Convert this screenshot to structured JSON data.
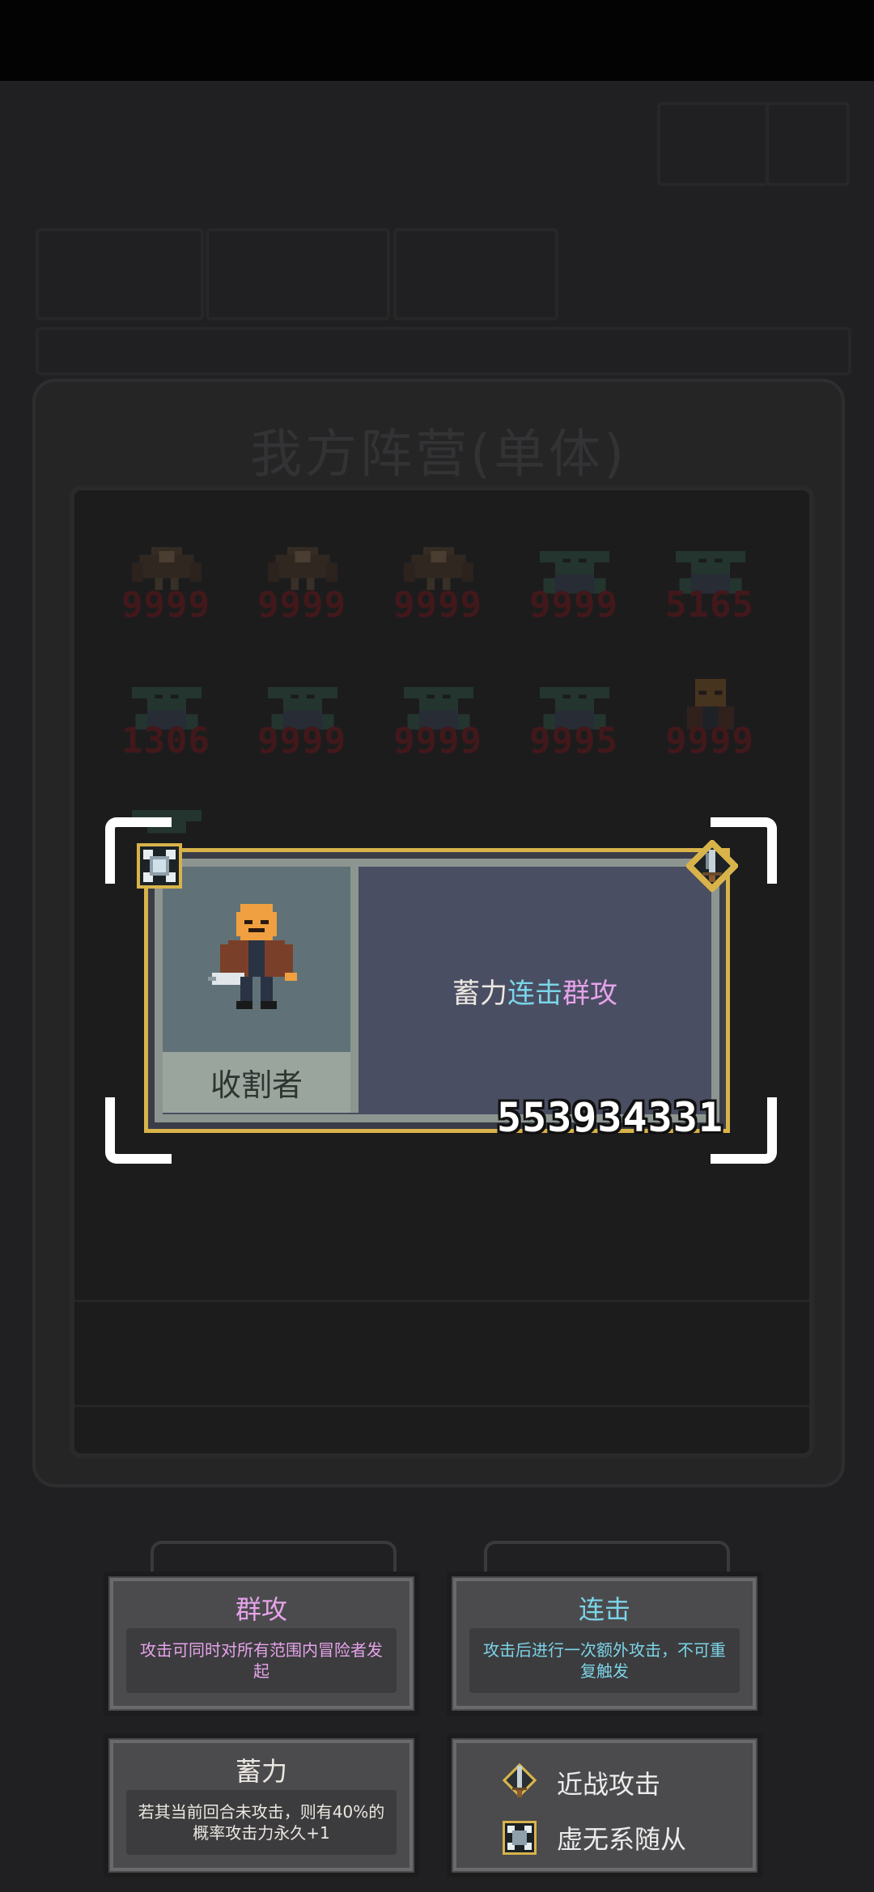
{
  "panel": {
    "title": "我方阵营(单体)"
  },
  "units": [
    {
      "kind": "bird",
      "hp": "9999"
    },
    {
      "kind": "bird",
      "hp": "9999"
    },
    {
      "kind": "bird",
      "hp": "9999"
    },
    {
      "kind": "goblin",
      "hp": "9999"
    },
    {
      "kind": "goblin",
      "hp": "5165"
    },
    {
      "kind": "goblin",
      "hp": "1306"
    },
    {
      "kind": "goblin",
      "hp": "9999"
    },
    {
      "kind": "goblin",
      "hp": "9999"
    },
    {
      "kind": "goblin",
      "hp": "9995"
    },
    {
      "kind": "reaper",
      "hp": "9999"
    },
    {
      "kind": "goblin-partial",
      "hp": ""
    }
  ],
  "card": {
    "name": "收割者",
    "desc_parts": [
      {
        "text": "蓄力",
        "color": "white"
      },
      {
        "text": "连击",
        "color": "cyan"
      },
      {
        "text": "群攻",
        "color": "pink"
      }
    ],
    "power": "553934331",
    "corner_icons": [
      "void-summon-icon",
      "melee-dagger-icon"
    ]
  },
  "traits": [
    {
      "title": "群攻",
      "title_color": "#e6a3ea",
      "body": "攻击可同时对所有范围内冒险者发起",
      "body_color": "#e6a3ea"
    },
    {
      "title": "连击",
      "title_color": "#7cd4e8",
      "body": "攻击后进行一次额外攻击，不可重复触发",
      "body_color": "#7cd4e8"
    },
    {
      "title": "蓄力",
      "title_color": "#ece7e1",
      "body": "若其当前回合未攻击，则有40%的概率攻击力永久+1",
      "body_color": "#ece7e1"
    }
  ],
  "legend": [
    {
      "icon": "melee-dagger-icon",
      "label": "近战攻击"
    },
    {
      "icon": "void-summon-icon",
      "label": "虚无系随从"
    }
  ],
  "colors": {
    "card_border": "#d8b34a",
    "damage_red": "#b3111a",
    "bracket": "#ffffff"
  }
}
